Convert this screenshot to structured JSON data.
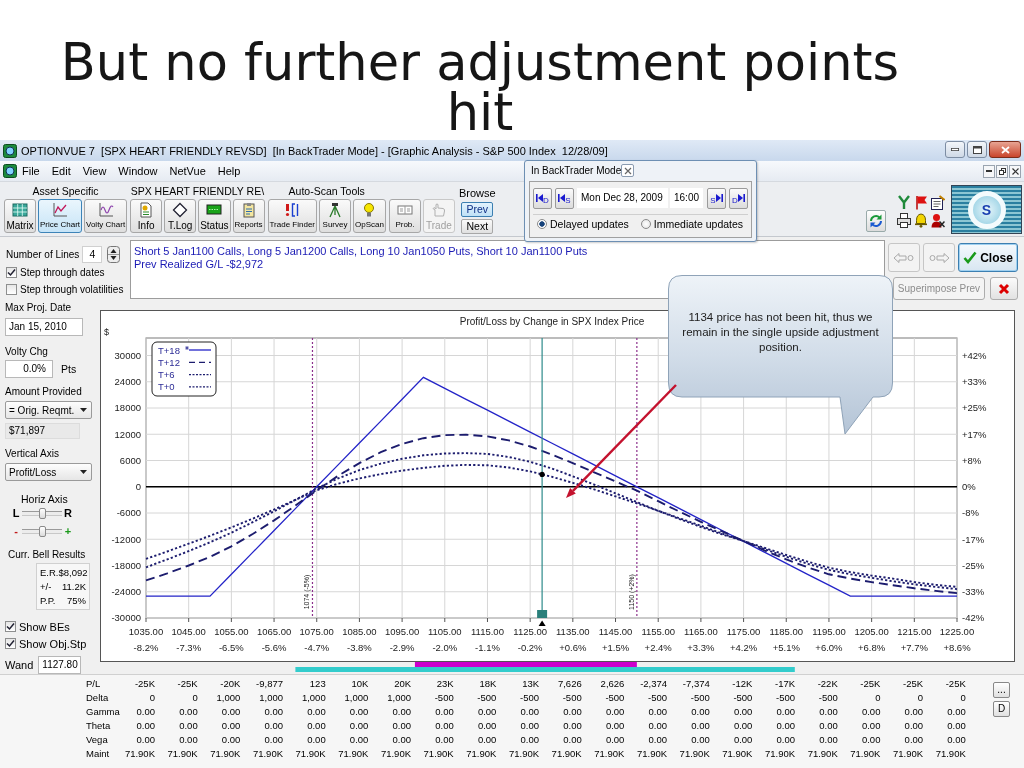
{
  "slide": {
    "title": "But no further adjustment points hit"
  },
  "window": {
    "title": "OPTIONVUE 7  [SPX HEART FRIENDLY REVSD]  [In BackTrader Mode] - [Graphic Analysis - S&P 500 Index  12/28/09]"
  },
  "menu": [
    "File",
    "Edit",
    "View",
    "Window",
    "NetVue",
    "Help"
  ],
  "toolbar": {
    "groups": [
      {
        "label": "Asset Specific",
        "buttons": [
          {
            "label": "Matrix",
            "selected": false,
            "disabled": false
          },
          {
            "label": "Price Chart",
            "selected": true,
            "disabled": false
          },
          {
            "label": "Volty Chart",
            "selected": false,
            "disabled": false
          }
        ]
      },
      {
        "label": "SPX HEART FRIENDLY RE\\",
        "buttons": [
          {
            "label": "Info",
            "selected": false,
            "disabled": false
          },
          {
            "label": "T.Log",
            "selected": false,
            "disabled": false
          },
          {
            "label": "Status",
            "selected": false,
            "disabled": false
          },
          {
            "label": "Reports",
            "selected": false,
            "disabled": false
          }
        ]
      },
      {
        "label": "Auto-Scan Tools",
        "buttons": [
          {
            "label": "Trade Finder",
            "selected": false,
            "disabled": false
          },
          {
            "label": "Survey",
            "selected": false,
            "disabled": false
          },
          {
            "label": "OpScan",
            "selected": false,
            "disabled": false
          }
        ]
      },
      {
        "buttons": [
          {
            "label": "Prob.",
            "selected": false,
            "disabled": false
          },
          {
            "label": "Trade",
            "selected": false,
            "disabled": true
          }
        ]
      }
    ],
    "browse": {
      "label": "Browse",
      "buttons": [
        {
          "label": "Prev",
          "selected": true
        },
        {
          "label": "Next",
          "selected": false
        }
      ]
    },
    "logo_letter": "S"
  },
  "backtrader": {
    "title": "In BackTrader Mode",
    "step_buttons": [
      {
        "kind": "back",
        "label": "D"
      },
      {
        "kind": "back",
        "label": "S"
      },
      {
        "kind": "forward",
        "label": "S"
      },
      {
        "kind": "forward",
        "label": "D"
      }
    ],
    "date": "Mon Dec 28, 2009",
    "time": "16:00",
    "update_modes": [
      {
        "label": "Delayed updates",
        "selected": true
      },
      {
        "label": "Immediate updates",
        "selected": false
      }
    ]
  },
  "controls": {
    "number_of_lines": {
      "label": "Number of Lines",
      "value": "4"
    },
    "step_options": [
      {
        "label": "Step through dates",
        "checked": true
      },
      {
        "label": "Step through volatilities",
        "checked": false
      }
    ],
    "max_proj_date": {
      "label": "Max Proj. Date",
      "value": "Jan 15, 2010"
    },
    "volty_chg": {
      "label": "Volty Chg",
      "value": "0.0%",
      "unit": "Pts"
    },
    "amount_provided": {
      "label": "Amount Provided",
      "value": "= Orig. Reqmt.",
      "amount": "$71,897"
    },
    "vertical_axis": {
      "label": "Vertical Axis",
      "value": "Profit/Loss"
    },
    "horiz_axis": {
      "label": "Horiz Axis",
      "sliders": [
        {
          "min_label": "L",
          "max_label": "R",
          "level": 0.5
        },
        {
          "min_label": "-",
          "max_label": "+",
          "level": 0.5
        }
      ]
    },
    "bell_results": {
      "label": "Curr. Bell Results",
      "rows": [
        {
          "name": "E.R.",
          "value": "$8,092"
        },
        {
          "name": "+/-",
          "value": "11.2K"
        },
        {
          "name": "P.P.",
          "value": "75%"
        }
      ]
    },
    "show_options": [
      {
        "label": "Show BEs",
        "checked": true
      },
      {
        "label": "Show Obj.Stp",
        "checked": true
      }
    ],
    "wand": {
      "label": "Wand",
      "value": "1127.80"
    }
  },
  "position": {
    "lines": [
      "Short 5 Jan1100 Calls, Long 5 Jan1200 Calls, Long 10 Jan1050 Puts, Short 10 Jan1100 Puts",
      "Prev Realized G/L -$2,972"
    ]
  },
  "actions": {
    "nav_buttons": [
      {
        "disabled": true
      },
      {
        "disabled": true
      }
    ],
    "close": {
      "label": "Close"
    },
    "superimpose": {
      "label": "Superimpose Prev",
      "disabled": true
    }
  },
  "chart": {
    "chart_data": {
      "type": "line",
      "title": "Profit/Loss by Change in SPX Index Price",
      "ylabel": "$",
      "x": [
        1035,
        1040,
        1045,
        1050,
        1055,
        1060,
        1065,
        1070,
        1075,
        1080,
        1085,
        1090,
        1095,
        1100,
        1105,
        1110,
        1115,
        1120,
        1125,
        1130,
        1135,
        1140,
        1145,
        1150,
        1155,
        1160,
        1165,
        1170,
        1175,
        1180,
        1185,
        1190,
        1195,
        1200,
        1205,
        1210,
        1215,
        1220,
        1225
      ],
      "series": [
        {
          "name": "T+18",
          "color": "#2424c8",
          "line_style": "solid",
          "values": [
            -25000,
            -25000,
            -25000,
            -25000,
            -20000,
            -15000,
            -10000,
            -5000,
            0,
            5000,
            10000,
            15000,
            20000,
            25000,
            22500,
            20000,
            17500,
            15000,
            12500,
            10000,
            7500,
            5000,
            2500,
            0,
            -2500,
            -5000,
            -7500,
            -10000,
            -12500,
            -15000,
            -17500,
            -20000,
            -22500,
            -25000,
            -25000,
            -25000,
            -25000,
            -25000,
            -25000
          ]
        },
        {
          "name": "T+12",
          "color": "#1c1c6e",
          "line_style": "dashed",
          "values": [
            -21400,
            -19800,
            -18000,
            -16000,
            -13600,
            -10800,
            -7700,
            -4300,
            -800,
            2500,
            5400,
            7900,
            9800,
            11100,
            11800,
            11900,
            11500,
            10600,
            9200,
            7400,
            5400,
            3300,
            1200,
            -900,
            -3300,
            -5700,
            -8000,
            -10200,
            -12400,
            -14600,
            -16600,
            -18400,
            -20000,
            -21000,
            -21800,
            -22500,
            -23200,
            -23800,
            -24300
          ]
        },
        {
          "name": "T+6",
          "color": "#1c1c6e",
          "line_style": "dotted",
          "values": [
            -18400,
            -16600,
            -14700,
            -12700,
            -10500,
            -8100,
            -5600,
            -3000,
            -400,
            1900,
            3800,
            5300,
            6400,
            7200,
            7600,
            7700,
            7500,
            6800,
            5700,
            4200,
            2400,
            500,
            -1500,
            -3500,
            -5500,
            -7400,
            -9200,
            -10900,
            -12400,
            -14300,
            -16000,
            -17600,
            -19000,
            -20000,
            -20800,
            -21600,
            -22300,
            -22900,
            -23400
          ]
        },
        {
          "name": "T+0",
          "color": "#1c1c6e",
          "line_style": "dotted",
          "values": [
            -16500,
            -14800,
            -13000,
            -11200,
            -9300,
            -7300,
            -5200,
            -3000,
            -800,
            700,
            1900,
            2900,
            3700,
            4300,
            4800,
            5000,
            4900,
            4400,
            3500,
            2300,
            900,
            -600,
            -2200,
            -3800,
            -5500,
            -7200,
            -8900,
            -10700,
            -12400,
            -14000,
            -15600,
            -17100,
            -18500,
            -19500,
            -20300,
            -21000,
            -21800,
            -22400,
            -22900
          ]
        }
      ],
      "xlim": [
        1035,
        1225
      ],
      "ylim": [
        -30000,
        34000
      ],
      "xticks": [
        {
          "value": 1035,
          "label": "1035.00"
        },
        {
          "value": 1045,
          "label": "1045.00"
        },
        {
          "value": 1055,
          "label": "1055.00"
        },
        {
          "value": 1065,
          "label": "1065.00"
        },
        {
          "value": 1075,
          "label": "1075.00"
        },
        {
          "value": 1085,
          "label": "1085.00"
        },
        {
          "value": 1095,
          "label": "1095.00"
        },
        {
          "value": 1105,
          "label": "1105.00"
        },
        {
          "value": 1115,
          "label": "1115.00"
        },
        {
          "value": 1125,
          "label": "1125.00"
        },
        {
          "value": 1135,
          "label": "1135.00"
        },
        {
          "value": 1145,
          "label": "1145.00"
        },
        {
          "value": 1155,
          "label": "1155.00"
        },
        {
          "value": 1165,
          "label": "1165.00"
        },
        {
          "value": 1175,
          "label": "1175.00"
        },
        {
          "value": 1185,
          "label": "1185.00"
        },
        {
          "value": 1195,
          "label": "1195.00"
        },
        {
          "value": 1205,
          "label": "1205.00"
        },
        {
          "value": 1215,
          "label": "1215.00"
        },
        {
          "value": 1225,
          "label": "1225.00"
        }
      ],
      "yticks": [
        -30000,
        -24000,
        -18000,
        -12000,
        -6000,
        0,
        6000,
        12000,
        18000,
        24000,
        30000
      ],
      "grid": true,
      "legend": true,
      "ref_lines": [
        {
          "axis": "x",
          "value": 1074,
          "label": "1074 (-5%)",
          "color": "#8b2f8b",
          "line_style": "dotted"
        },
        {
          "axis": "x",
          "value": 1150,
          "label": "1150 (+2%)",
          "color": "#8b2f8b",
          "line_style": "dotted"
        },
        {
          "axis": "x",
          "value": 1127.8,
          "color": "#2e8b8b",
          "line_style": "solid"
        }
      ]
    },
    "x_percent_labels": [
      "-8.2%",
      "-7.3%",
      "-6.5%",
      "-5.6%",
      "-4.7%",
      "-3.8%",
      "-2.9%",
      "-2.0%",
      "-1.1%",
      "-0.2%",
      "+0.6%",
      "+1.5%",
      "+2.4%",
      "+3.3%",
      "+4.2%",
      "+5.1%",
      "+6.0%",
      "+6.8%",
      "+7.7%",
      "+8.6%"
    ],
    "y_percent_labels": [
      "+42%",
      "+33%",
      "+25%",
      "+17%",
      "+8%",
      "0%",
      "-8%",
      "-17%",
      "-25%",
      "-33%",
      "-42%"
    ]
  },
  "callout": {
    "text": "1134 price has not been hit, thus we remain in the single upside adjustment position."
  },
  "greeks_table": {
    "rows": [
      {
        "label": "P/L",
        "values": [
          "-25K",
          "-25K",
          "-20K",
          "-9,877",
          "123",
          "10K",
          "20K",
          "23K",
          "18K",
          "13K",
          "7,626",
          "2,626",
          "-2,374",
          "-7,374",
          "-12K",
          "-17K",
          "-22K",
          "-25K",
          "-25K",
          "-25K"
        ]
      },
      {
        "label": "Delta",
        "values": [
          "0",
          "0",
          "1,000",
          "1,000",
          "1,000",
          "1,000",
          "1,000",
          "-500",
          "-500",
          "-500",
          "-500",
          "-500",
          "-500",
          "-500",
          "-500",
          "-500",
          "-500",
          "0",
          "0",
          "0"
        ]
      },
      {
        "label": "Gamma",
        "values": [
          "0.00",
          "0.00",
          "0.00",
          "0.00",
          "0.00",
          "0.00",
          "0.00",
          "0.00",
          "0.00",
          "0.00",
          "0.00",
          "0.00",
          "0.00",
          "0.00",
          "0.00",
          "0.00",
          "0.00",
          "0.00",
          "0.00",
          "0.00"
        ]
      },
      {
        "label": "Theta",
        "values": [
          "0.00",
          "0.00",
          "0.00",
          "0.00",
          "0.00",
          "0.00",
          "0.00",
          "0.00",
          "0.00",
          "0.00",
          "0.00",
          "0.00",
          "0.00",
          "0.00",
          "0.00",
          "0.00",
          "0.00",
          "0.00",
          "0.00",
          "0.00"
        ]
      },
      {
        "label": "Vega",
        "values": [
          "0.00",
          "0.00",
          "0.00",
          "0.00",
          "0.00",
          "0.00",
          "0.00",
          "0.00",
          "0.00",
          "0.00",
          "0.00",
          "0.00",
          "0.00",
          "0.00",
          "0.00",
          "0.00",
          "0.00",
          "0.00",
          "0.00",
          "0.00"
        ]
      },
      {
        "label": "Maint",
        "values": [
          "71.90K",
          "71.90K",
          "71.90K",
          "71.90K",
          "71.90K",
          "71.90K",
          "71.90K",
          "71.90K",
          "71.90K",
          "71.90K",
          "71.90K",
          "71.90K",
          "71.90K",
          "71.90K",
          "71.90K",
          "71.90K",
          "71.90K",
          "71.90K",
          "71.90K",
          "71.90K"
        ]
      }
    ],
    "buttons": [
      "...",
      "D"
    ]
  }
}
